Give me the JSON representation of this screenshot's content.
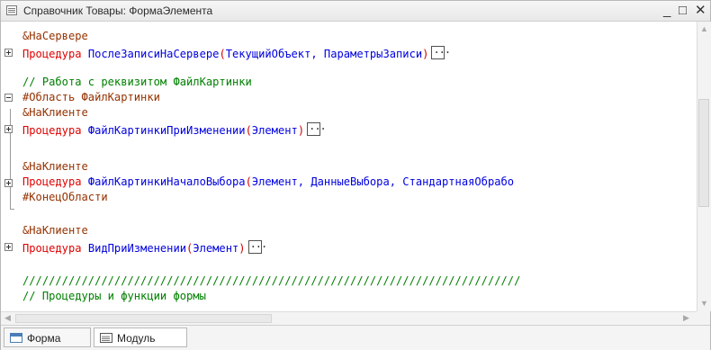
{
  "window": {
    "title": "Справочник Товары: ФормаЭлемента",
    "minimize": "_",
    "maximize": "□",
    "close": "✕"
  },
  "code": {
    "l1_pre": "&НаСервере",
    "l2_kw": "Процедура",
    "l2_fn": "ПослеЗаписиНаСервере",
    "l2_open": "(",
    "l2_args": "ТекущийОбъект, ПараметрыЗаписи",
    "l2_close": ")",
    "l4_cm": "// Работа с реквизитом ФайлКартинки",
    "l5_pre": "#Область ФайлКартинки",
    "l6_pre": "&НаКлиенте",
    "l7_kw": "Процедура",
    "l7_fn": "ФайлКартинкиПриИзменении",
    "l7_open": "(",
    "l7_args": "Элемент",
    "l7_close": ")",
    "l9_pre": "&НаКлиенте",
    "l10_kw": "Процедура",
    "l10_fn": "ФайлКартинкиНачалоВыбора",
    "l10_open": "(",
    "l10_args": "Элемент, ДанныеВыбора, СтандартнаяОбрабо",
    "l11_pre": "#КонецОбласти",
    "l13_pre": "&НаКлиенте",
    "l14_kw": "Процедура",
    "l14_fn": "ВидПриИзменении",
    "l14_open": "(",
    "l14_args": "Элемент",
    "l14_close": ")",
    "l16_cm": "////////////////////////////////////////////////////////////////////////////",
    "l17_cm": "// Процедуры и функции формы"
  },
  "tabs": [
    {
      "label": "Форма"
    },
    {
      "label": "Модуль"
    }
  ]
}
